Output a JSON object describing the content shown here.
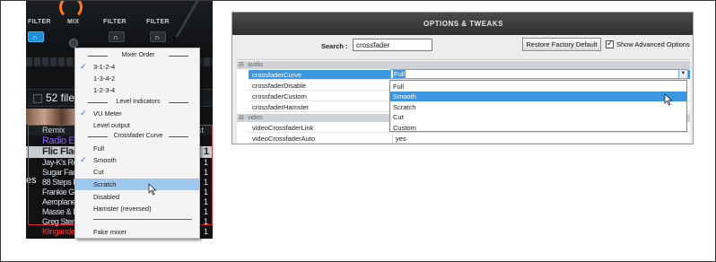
{
  "dj": {
    "fx_labels": [
      "FILTER",
      "MIX",
      "FILTER",
      "FILTER"
    ],
    "files_count": "52 files",
    "col_remix": "Remix",
    "col_right": "rst",
    "es_label": "es",
    "tracks": [
      {
        "name": "Radio E",
        "num": "",
        "style": "c-purple"
      },
      {
        "name": "Flic Flac",
        "num": "1",
        "style": "sel"
      },
      {
        "name": "Jay-K's Re",
        "num": "1",
        "style": ""
      },
      {
        "name": "Sugar Facto",
        "num": "1",
        "style": ""
      },
      {
        "name": "88 Steps Re",
        "num": "1",
        "style": ""
      },
      {
        "name": "Frankie Goe",
        "num": "1",
        "style": ""
      },
      {
        "name": "Aeroplane R",
        "num": "1",
        "style": ""
      },
      {
        "name": "Masse & Bo",
        "num": "1",
        "style": ""
      },
      {
        "name": "Greg Stent",
        "num": "1",
        "style": ""
      },
      {
        "name": "Klingande",
        "num": "1",
        "style": "c-red"
      }
    ]
  },
  "menu": {
    "sep_mixer_order": "Mixer Order",
    "opt_3124": "3-1-2-4",
    "opt_1342": "1-3-4-2",
    "opt_1234": "1-2-3-4",
    "sep_level": "Level Indicators",
    "vu_meter": "VU Meter",
    "level_output": "Level output",
    "sep_crossfader": "Crossfader Curve",
    "full": "Full",
    "smooth": "Smooth",
    "cut": "Cut",
    "scratch": "Scratch",
    "disabled": "Disabled",
    "hamster": "Hamster (reversed)",
    "fake_mixer": "Fake mixer"
  },
  "options": {
    "title": "OPTIONS & TWEAKS",
    "search_label": "Search :",
    "search_value": "crossfader",
    "restore_button": "Restore Factory Default",
    "show_advanced": "Show Advanced Options",
    "group_audio": "audio",
    "group_video": "video",
    "rows": {
      "curve_key": "crossfaderCurve",
      "disable_key": "crossfaderDisable",
      "custom_key": "crossfaderCustom",
      "hamster_key": "crossfaderHamster",
      "vlink_key": "videoCrossfaderLink",
      "vauto_key": "videoCrossfaderAuto",
      "vauto_val": "yes"
    },
    "select_value": "Full",
    "dropdown": [
      "Full",
      "Smooth",
      "Scratch",
      "Cut",
      "Custom"
    ]
  }
}
